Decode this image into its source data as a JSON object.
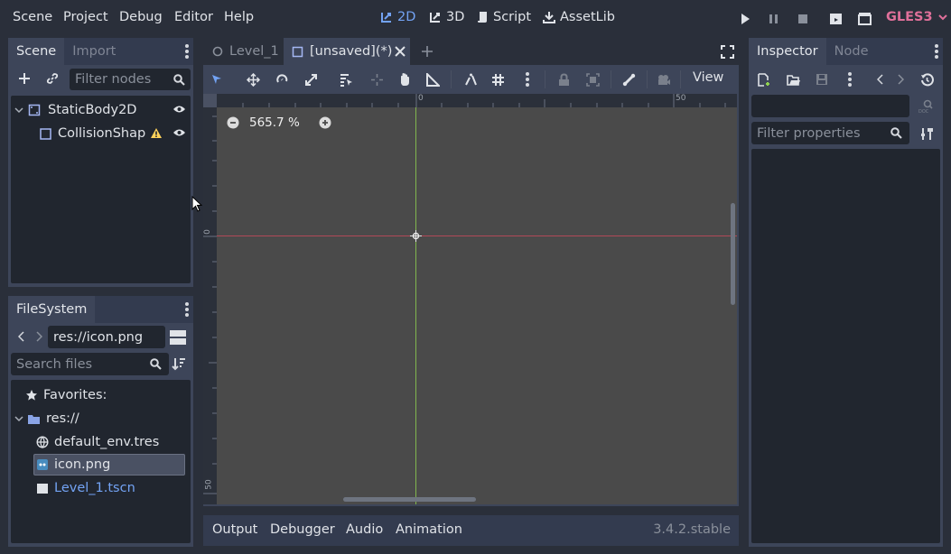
{
  "menu": [
    "Scene",
    "Project",
    "Debug",
    "Editor",
    "Help"
  ],
  "workspaces": {
    "w2d": "2D",
    "w3d": "3D",
    "script": "Script",
    "assetlib": "AssetLib"
  },
  "renderer": "GLES3",
  "scene_dock": {
    "tabs": [
      "Scene",
      "Import"
    ],
    "filter_placeholder": "Filter nodes",
    "nodes": [
      {
        "label": "StaticBody2D"
      },
      {
        "label": "CollisionShap"
      }
    ]
  },
  "filesystem": {
    "tab": "FileSystem",
    "path": "res://icon.png",
    "search_placeholder": "Search files",
    "favorites": "Favorites:",
    "root": "res://",
    "files": [
      "default_env.tres",
      "icon.png",
      "Level_1.tscn"
    ]
  },
  "editor_tabs": {
    "level": "Level_1",
    "unsaved": "[unsaved](*)"
  },
  "toolbar": {
    "view": "View"
  },
  "viewport": {
    "zoom": "565.7 %",
    "ruler_0": "0",
    "ruler_50": "50",
    "ruler_v0": "0",
    "ruler_v50": "50"
  },
  "bottom_panel": {
    "tabs": [
      "Output",
      "Debugger",
      "Audio",
      "Animation"
    ],
    "version": "3.4.2.stable"
  },
  "inspector": {
    "tabs": [
      "Inspector",
      "Node"
    ],
    "filter_placeholder": "Filter properties"
  },
  "colors": {
    "accent": "#73a3f4",
    "renderer": "#e0709a",
    "warning": "#ffd25a",
    "axis_x": "#d44a5d",
    "axis_y": "#8fd14f"
  }
}
